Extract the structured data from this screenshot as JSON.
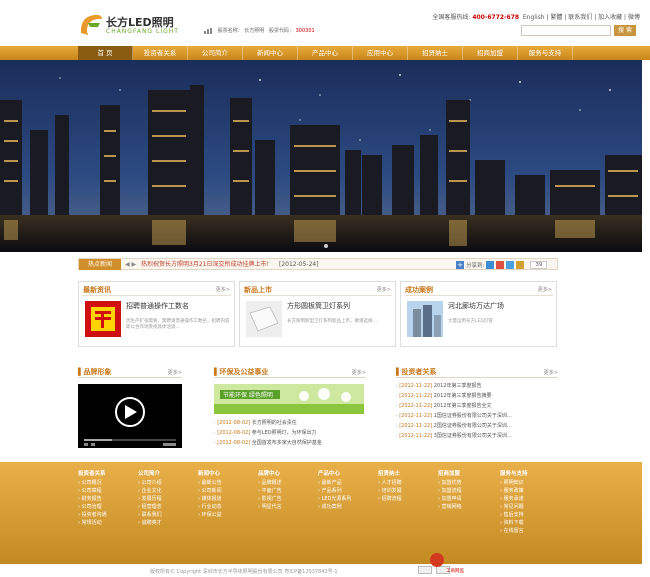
{
  "header": {
    "logo_brand": "长方LED照明",
    "logo_sub": "CHANGFANG LIGHT",
    "stock_label1": "股票名称：",
    "stock_name": "长方照明",
    "stock_label2": "股票代码：",
    "stock_code": "300301",
    "hotline_label": "全国客服热线:",
    "hotline": "400-6772-678",
    "top_links": [
      "English",
      "繁體",
      "联系我们",
      "加入收藏",
      "微博"
    ],
    "search_button": "搜 索",
    "search_placeholder": ""
  },
  "nav": [
    "首 页",
    "投资者关系",
    "公司简介",
    "新闻中心",
    "产品中心",
    "应用中心",
    "招贤纳士",
    "招商加盟",
    "服务与支持"
  ],
  "ticker": {
    "label": "热点新闻",
    "arrows": "◀ ▶",
    "text": "热烈祝贺长方照明3月21日深交所成功挂牌上市!",
    "date": "[2012-05-24]",
    "share_label": "分享到:",
    "count": "39"
  },
  "cards": [
    {
      "title": "最新资讯",
      "more": "更多>",
      "headline": "招聘普通操作工数名",
      "desc": "因生产扩张需要，需聘请普通操作工数名，招聘内容即以合作场景视具体洽谈…"
    },
    {
      "title": "新品上市",
      "more": "更多>",
      "headline": "方形圆板筒卫灯系列",
      "desc": "长方照明新型卫灯系列新品上市，敬请选择…"
    },
    {
      "title": "成功案例",
      "more": "更多>",
      "headline": "河北廊坊万达广场",
      "desc": "大量运用长方LED灯管"
    }
  ],
  "brand_section": {
    "title": "品牌形象",
    "more": "更多>"
  },
  "eco_section": {
    "title": "环保及公益事业",
    "more": "更多>",
    "banner_text": "节能环保 绿色照明",
    "items": [
      {
        "date": "[2012-08-02]",
        "text": "长方照明的社会责任"
      },
      {
        "date": "[2012-08-02]",
        "text": "参与LED照明灯，为环保出力"
      },
      {
        "date": "[2012-08-02]",
        "text": "全国首发布多家大自然保护基金"
      }
    ]
  },
  "investor_section": {
    "title": "投资者关系",
    "more": "更多>",
    "items": [
      {
        "date": "[2012-11-22]",
        "text": "2012年第三季度报告"
      },
      {
        "date": "[2012-11-22]",
        "text": "2012年第三季度报告摘要"
      },
      {
        "date": "[2012-11-22]",
        "text": "2012年第三季度报告全文"
      },
      {
        "date": "[2012-11-22]",
        "text": "1国信证券股份有限公司关于深圳…"
      },
      {
        "date": "[2012-11-22]",
        "text": "2国信证券股份有限公司关于深圳…"
      },
      {
        "date": "[2012-11-22]",
        "text": "3国信证券股份有限公司关于深圳…"
      }
    ]
  },
  "footer": [
    {
      "title": "投资者关系",
      "items": [
        "公司概况",
        "公司章程",
        "财务报告",
        "公司治理",
        "投资者沟通",
        "常规活动"
      ]
    },
    {
      "title": "公司简介",
      "items": [
        "公司介绍",
        "企业文化",
        "发展历程",
        "经营理念",
        "联系我们",
        "诚聘英才"
      ]
    },
    {
      "title": "新闻中心",
      "items": [
        "最新公告",
        "公司新闻",
        "媒体报道",
        "行业动态",
        "环保公益"
      ]
    },
    {
      "title": "品牌中心",
      "items": [
        "品牌概述",
        "平面广告",
        "影视广告",
        "明星代言"
      ]
    },
    {
      "title": "产品中心",
      "items": [
        "最新产品",
        "产品系列",
        "LED光源系列",
        "成功案例"
      ]
    },
    {
      "title": "招贤纳士",
      "items": [
        "人才招聘",
        "培训发展",
        "招聘流程"
      ]
    },
    {
      "title": "招商加盟",
      "items": [
        "加盟优势",
        "加盟流程",
        "加盟申请",
        "营销网络"
      ]
    },
    {
      "title": "服务与支持",
      "items": [
        "照明知识",
        "服务政策",
        "服务承诺",
        "常见问题",
        "售后支持",
        "资料下载",
        "在线留言"
      ]
    }
  ],
  "copyright": "版权所有© Copyright 深圳市长方半导体照明股份有限公司  粤ICP备12037842号-1",
  "emblem_text": "工商网监",
  "colors": {
    "accent": "#d08f2a",
    "nav_top": "#e8aa3a",
    "nav_active": "#8a5c12",
    "logo_green": "#6aa82a",
    "hotline_red": "#cc0000"
  }
}
